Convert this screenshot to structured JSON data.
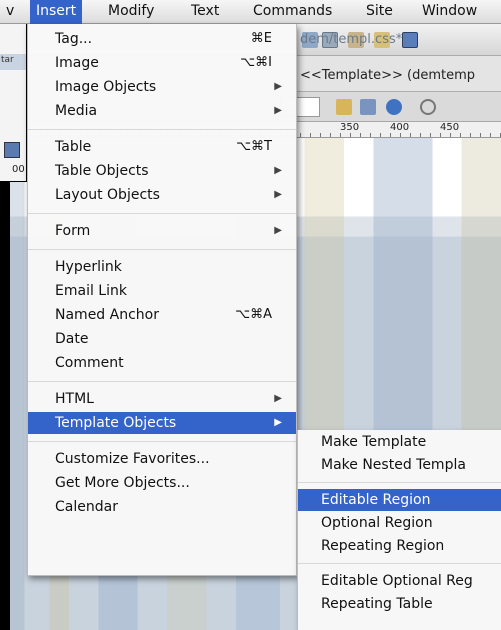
{
  "menubar": {
    "items": [
      "v",
      "Insert",
      "Modify",
      "Text",
      "Commands",
      "Site",
      "Window"
    ],
    "active": "Insert"
  },
  "background": {
    "file_path": "dem/templ.css*)",
    "tag_path": "<<Template>> (demtemp",
    "ruler_labels": [
      "350",
      "400",
      "450"
    ],
    "left_label": "tar",
    "left_numbers": "00"
  },
  "insert_menu": {
    "groups": [
      [
        {
          "label": "Tag...",
          "shortcut": "⌘E",
          "submenu": false
        },
        {
          "label": "Image",
          "shortcut": "⌥⌘I",
          "submenu": false
        },
        {
          "label": "Image Objects",
          "shortcut": "",
          "submenu": true
        },
        {
          "label": "Media",
          "shortcut": "",
          "submenu": true
        }
      ],
      [
        {
          "label": "Table",
          "shortcut": "⌥⌘T",
          "submenu": false
        },
        {
          "label": "Table Objects",
          "shortcut": "",
          "submenu": true
        },
        {
          "label": "Layout Objects",
          "shortcut": "",
          "submenu": true
        }
      ],
      [
        {
          "label": "Form",
          "shortcut": "",
          "submenu": true
        }
      ],
      [
        {
          "label": "Hyperlink",
          "shortcut": "",
          "submenu": false
        },
        {
          "label": "Email Link",
          "shortcut": "",
          "submenu": false
        },
        {
          "label": "Named Anchor",
          "shortcut": "⌥⌘A",
          "submenu": false
        },
        {
          "label": "Date",
          "shortcut": "",
          "submenu": false
        },
        {
          "label": "Comment",
          "shortcut": "",
          "submenu": false
        }
      ],
      [
        {
          "label": "HTML",
          "shortcut": "",
          "submenu": true
        },
        {
          "label": "Template Objects",
          "shortcut": "",
          "submenu": true,
          "highlighted": true
        }
      ],
      [
        {
          "label": "Customize Favorites...",
          "shortcut": "",
          "submenu": false
        },
        {
          "label": "Get More Objects...",
          "shortcut": "",
          "submenu": false
        },
        {
          "label": "Calendar",
          "shortcut": "",
          "submenu": false
        }
      ]
    ]
  },
  "template_submenu": {
    "groups": [
      [
        {
          "label": "Make Template"
        },
        {
          "label": "Make Nested Templa"
        }
      ],
      [
        {
          "label": "Editable Region",
          "highlighted": true
        },
        {
          "label": "Optional Region"
        },
        {
          "label": "Repeating Region"
        }
      ],
      [
        {
          "label": "Editable Optional Reg"
        },
        {
          "label": "Repeating Table"
        }
      ]
    ]
  },
  "colors": {
    "highlight": "#3463c9",
    "menu_bg": "#f8f8f8"
  },
  "icons": {
    "submenu_arrow": "▶"
  }
}
